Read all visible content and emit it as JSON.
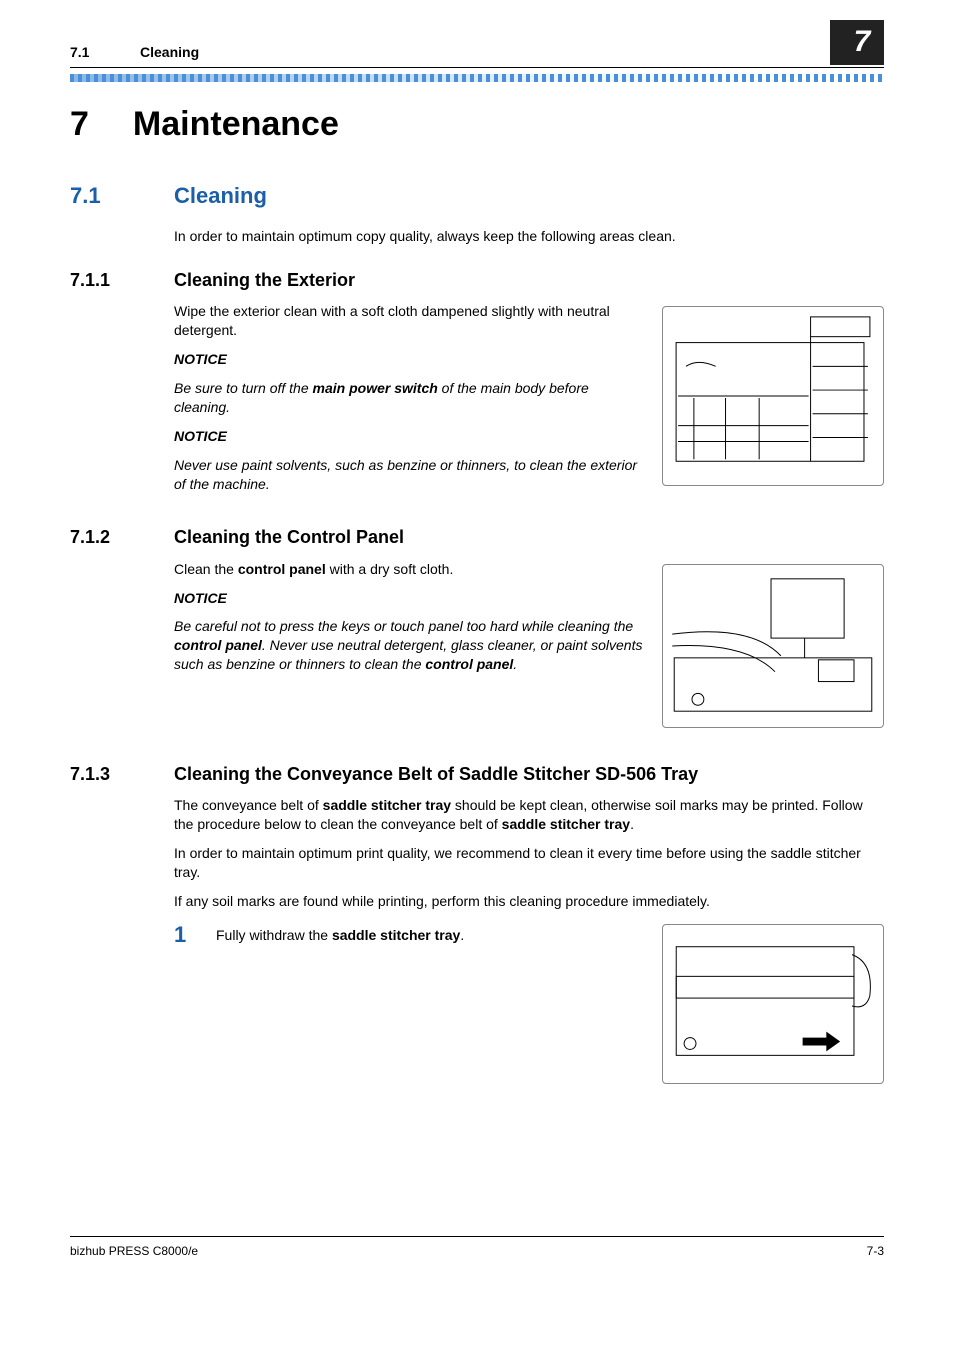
{
  "header": {
    "section_number": "7.1",
    "section_title": "Cleaning",
    "chapter_number": "7"
  },
  "chapter": {
    "number": "7",
    "title": "Maintenance"
  },
  "h1": {
    "number": "7.1",
    "title": "Cleaning",
    "intro": "In order to maintain optimum copy quality, always keep the following areas clean."
  },
  "s711": {
    "number": "7.1.1",
    "title": "Cleaning the Exterior",
    "p1": "Wipe the exterior clean with a soft cloth dampened slightly with neutral detergent.",
    "notice1_label": "NOTICE",
    "notice1_pre": "Be sure to turn off the ",
    "notice1_bold": "main power switch",
    "notice1_post": " of the main body before cleaning.",
    "notice2_label": "NOTICE",
    "notice2_text": "Never use paint solvents, such as benzine or thinners, to clean the exterior of the machine."
  },
  "s712": {
    "number": "7.1.2",
    "title": "Cleaning the Control Panel",
    "p1_pre": "Clean the ",
    "p1_bold": "control panel",
    "p1_post": " with a dry soft cloth.",
    "notice_label": "NOTICE",
    "notice_pre": "Be careful not to press the keys or touch panel too hard while cleaning the ",
    "notice_b1": "control panel",
    "notice_mid": ". Never use neutral detergent, glass cleaner, or paint solvents such as benzine or thinners to clean the ",
    "notice_b2": "control panel",
    "notice_post": "."
  },
  "s713": {
    "number": "7.1.3",
    "title": "Cleaning the Conveyance Belt of Saddle Stitcher SD-506 Tray",
    "p1_pre": "The conveyance belt of ",
    "p1_b1": "saddle stitcher tray",
    "p1_mid": " should be kept clean, otherwise soil marks may be printed. Follow the procedure below to clean the conveyance belt of ",
    "p1_b2": "saddle stitcher tray",
    "p1_post": ".",
    "p2": "In order to maintain optimum print quality, we recommend to clean it every time before using the saddle stitcher tray.",
    "p3": "If any soil marks are found while printing, perform this cleaning procedure immediately.",
    "step1_num": "1",
    "step1_pre": "Fully withdraw the ",
    "step1_bold": "saddle stitcher tray",
    "step1_post": "."
  },
  "footer": {
    "left": "bizhub PRESS C8000/e",
    "right": "7-3"
  }
}
